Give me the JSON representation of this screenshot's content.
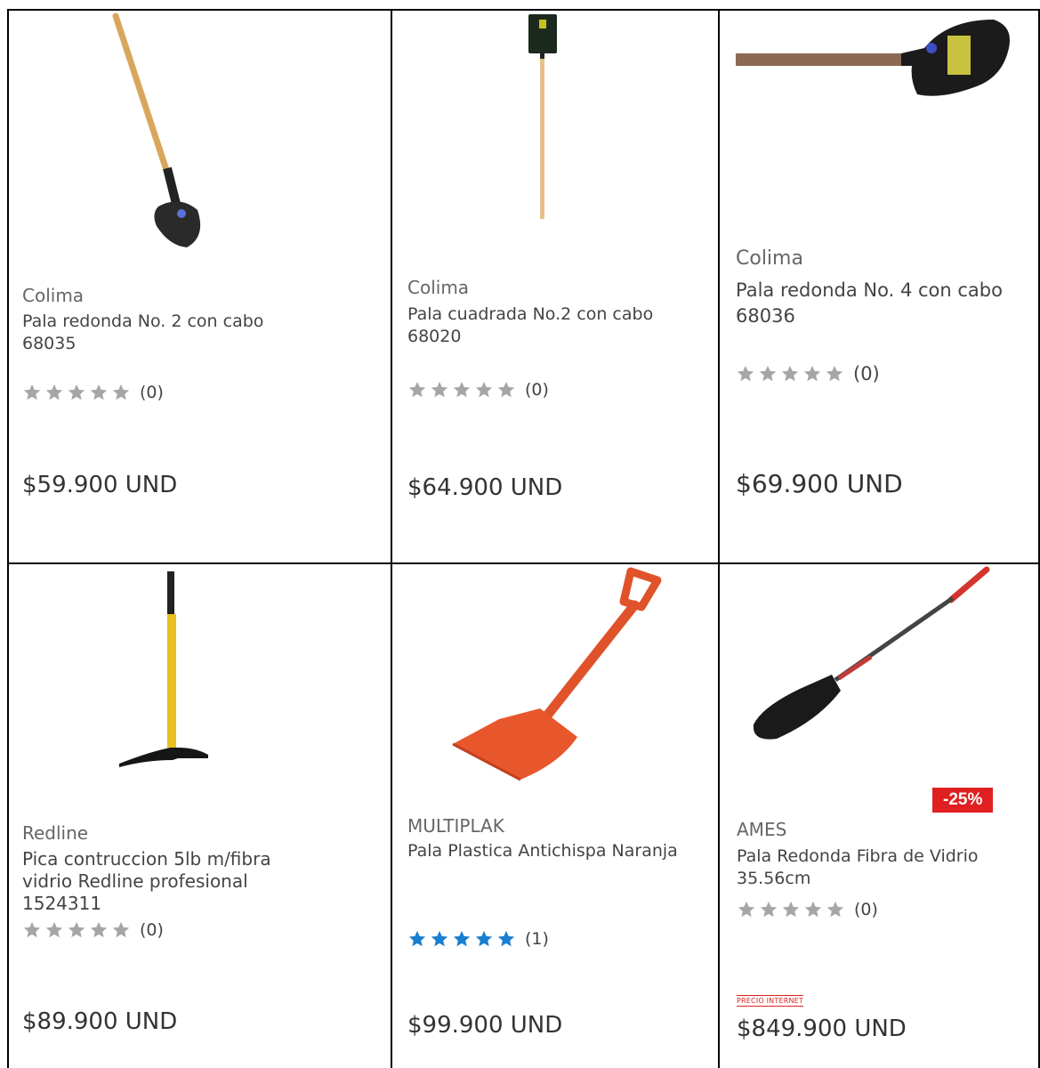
{
  "products": [
    {
      "brand": "Colima",
      "title_line1": "Pala redonda No. 2 con cabo",
      "title_line2": "68035",
      "title_line3": "",
      "rating": 0,
      "count": "(0)",
      "price": "$59.900 UND"
    },
    {
      "brand": "Colima",
      "title_line1": "Pala cuadrada No.2 con cabo",
      "title_line2": "68020",
      "title_line3": "",
      "rating": 0,
      "count": "(0)",
      "price": "$64.900 UND"
    },
    {
      "brand": "Colima",
      "title_line1": "Pala redonda No. 4 con cabo",
      "title_line2": "68036",
      "title_line3": "",
      "rating": 0,
      "count": "(0)",
      "price": "$69.900 UND"
    },
    {
      "brand": "Redline",
      "title_line1": "Pica contruccion 5lb m/fibra",
      "title_line2": "vidrio Redline profesional",
      "title_line3": "1524311",
      "rating": 0,
      "count": "(0)",
      "price": "$89.900 UND"
    },
    {
      "brand": "MULTIPLAK",
      "title_line1": "Pala Plastica Antichispa Naranja",
      "title_line2": "",
      "title_line3": "",
      "rating": 5,
      "count": "(1)",
      "price": "$99.900 UND"
    },
    {
      "brand": "AMES",
      "title_line1": "Pala Redonda Fibra de Vidrio",
      "title_line2": "35.56cm",
      "title_line3": "",
      "rating": 0,
      "count": "(0)",
      "price": "$849.900 UND",
      "discount": "-25%",
      "price_tag": "PRECIO INTERNET"
    }
  ],
  "colors": {
    "star_empty": "#a6a6a6",
    "star_filled": "#1a7fd0",
    "discount_bg": "#e02020"
  },
  "icons": [
    "shovel-round-icon",
    "shovel-square-icon",
    "shovel-round-large-icon",
    "pickaxe-icon",
    "plastic-shovel-icon",
    "fiberglass-shovel-icon",
    "star-icon"
  ]
}
